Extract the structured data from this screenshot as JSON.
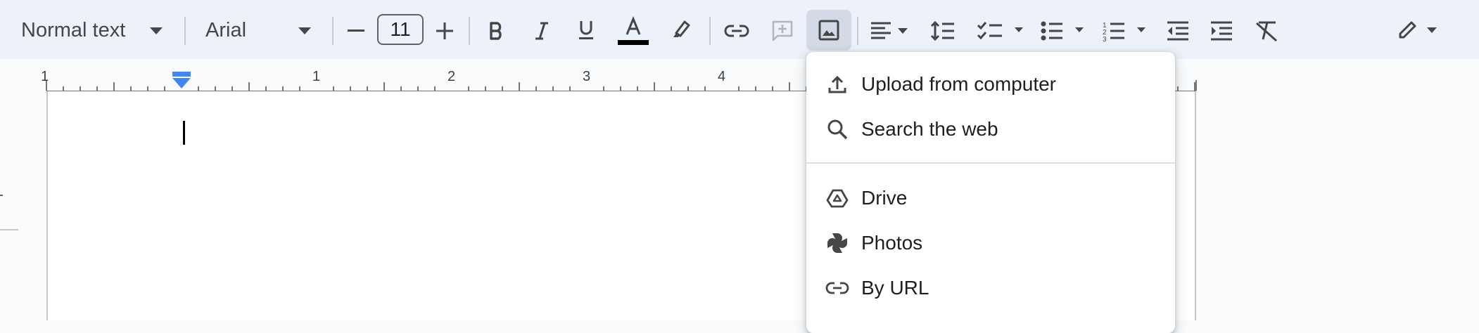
{
  "toolbar": {
    "paragraph_style": "Normal text",
    "font_family": "Arial",
    "font_size": "11",
    "text_color_underline": "#000000",
    "icons": [
      "dropdown-icon",
      "minus-icon",
      "plus-icon",
      "bold-icon",
      "italic-icon",
      "underline-icon",
      "text-color-icon",
      "highlight-icon",
      "link-icon",
      "add-comment-icon",
      "image-icon",
      "align-icon",
      "line-spacing-icon",
      "checklist-icon",
      "bulleted-list-icon",
      "numbered-list-icon",
      "decrease-indent-icon",
      "increase-indent-icon",
      "clear-formatting-icon",
      "edit-mode-icon"
    ]
  },
  "ruler": {
    "numbers": [
      "1",
      "1",
      "2",
      "3",
      "4"
    ]
  },
  "image_menu": {
    "items": [
      {
        "label": "Upload from computer",
        "icon": "upload-icon"
      },
      {
        "label": "Search the web",
        "icon": "search-icon"
      },
      {
        "label": "Drive",
        "icon": "drive-icon"
      },
      {
        "label": "Photos",
        "icon": "photos-icon"
      },
      {
        "label": "By URL",
        "icon": "link-icon"
      }
    ]
  },
  "colors": {
    "toolbar_bg": "#edf2fa",
    "indent_marker": "#4285f4"
  }
}
